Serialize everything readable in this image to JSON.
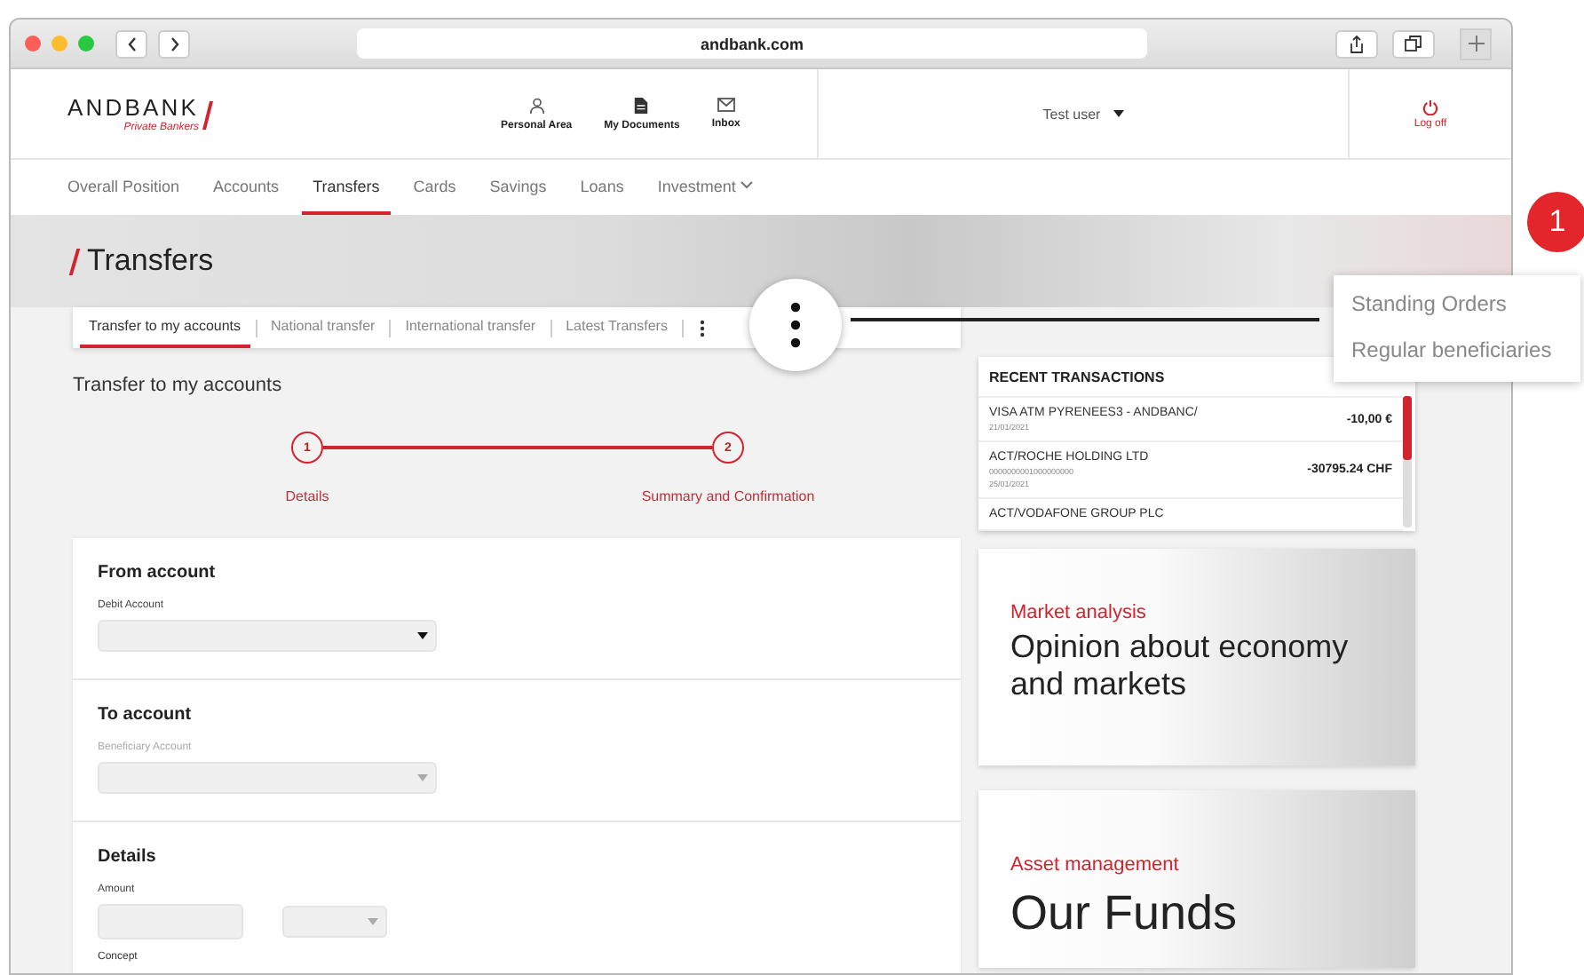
{
  "browser": {
    "url": "andbank.com"
  },
  "header": {
    "logo": {
      "name": "ANDBANK",
      "tagline": "Private Bankers"
    },
    "shortcuts": [
      {
        "label": "Personal Area",
        "kind": "person"
      },
      {
        "label": "My Documents",
        "kind": "document"
      },
      {
        "label": "Inbox",
        "kind": "mail"
      }
    ],
    "user": {
      "name": "Test user"
    },
    "logout": {
      "label": "Log off"
    }
  },
  "nav": [
    {
      "label": "Overall Position",
      "selected": false,
      "dropdown": false
    },
    {
      "label": "Accounts",
      "selected": false,
      "dropdown": false
    },
    {
      "label": "Transfers",
      "selected": true,
      "dropdown": false
    },
    {
      "label": "Cards",
      "selected": false,
      "dropdown": false
    },
    {
      "label": "Savings",
      "selected": false,
      "dropdown": false
    },
    {
      "label": "Loans",
      "selected": false,
      "dropdown": false
    },
    {
      "label": "Investment",
      "selected": false,
      "dropdown": true
    }
  ],
  "page": {
    "title": "Transfers",
    "tabs": [
      {
        "label": "Transfer to my accounts",
        "selected": true
      },
      {
        "label": "National transfer",
        "selected": false
      },
      {
        "label": "International transfer",
        "selected": false
      },
      {
        "label": "Latest Transfers",
        "selected": false
      }
    ],
    "section_title": "Transfer to my accounts",
    "steps": [
      {
        "number": "1",
        "label": "Details"
      },
      {
        "number": "2",
        "label": "Summary and Confirmation"
      }
    ],
    "form": [
      {
        "title": "From account",
        "fields": [
          {
            "kind": "select",
            "label": "Debit Account",
            "disabled": false
          }
        ]
      },
      {
        "title": "To account",
        "fields": [
          {
            "kind": "select",
            "label": "Beneficiary Account",
            "disabled": true
          }
        ]
      },
      {
        "title": "Details",
        "fields": [
          {
            "kind": "amount",
            "label": "Amount",
            "disabled": false
          },
          {
            "kind": "caption",
            "label": "Concept"
          }
        ]
      }
    ]
  },
  "recent_transactions": {
    "title": "RECENT TRANSACTIONS",
    "items": [
      {
        "description": "VISA ATM PYRENEES3 - ANDBANC/",
        "date": "21/01/2021",
        "amount": "-10,00 €"
      },
      {
        "description": "ACT/ROCHE HOLDING LTD",
        "reference": "0000000001000000000",
        "date": "25/01/2021",
        "amount": "-30795.24 CHF"
      },
      {
        "description": "ACT/VODAFONE GROUP PLC"
      }
    ]
  },
  "promos": [
    {
      "category": "Market analysis",
      "headline": "Opinion about economy and markets"
    },
    {
      "category": "Asset management",
      "headline": "Our Funds"
    }
  ],
  "callout": {
    "number": "1",
    "menu": [
      {
        "label": "Standing Orders"
      },
      {
        "label": "Regular beneficiaries"
      }
    ]
  }
}
